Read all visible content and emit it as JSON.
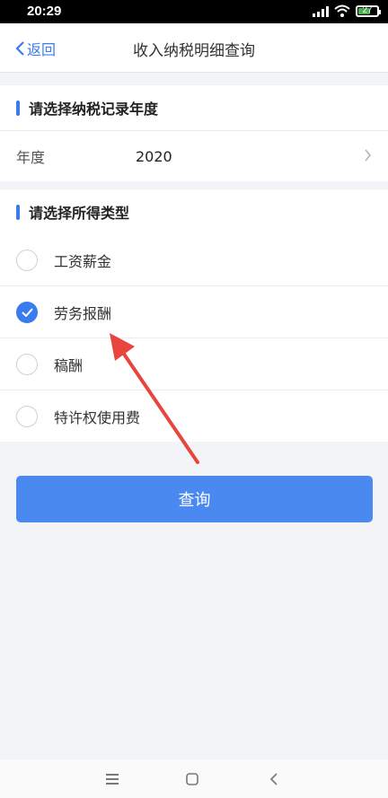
{
  "status_bar": {
    "time": "20:29",
    "battery": "27"
  },
  "header": {
    "back_label": "返回",
    "title": "收入纳税明细查询"
  },
  "year_section": {
    "title": "请选择纳税记录年度",
    "field_label": "年度",
    "field_value": "2020"
  },
  "type_section": {
    "title": "请选择所得类型",
    "options": [
      {
        "label": "工资薪金",
        "selected": false
      },
      {
        "label": "劳务报酬",
        "selected": true
      },
      {
        "label": "稿酬",
        "selected": false
      },
      {
        "label": "特许权使用费",
        "selected": false
      }
    ]
  },
  "query_button": {
    "label": "查询"
  },
  "colors": {
    "accent": "#3a7bef",
    "button": "#4a89f0",
    "annotation_arrow": "#e8453c"
  }
}
